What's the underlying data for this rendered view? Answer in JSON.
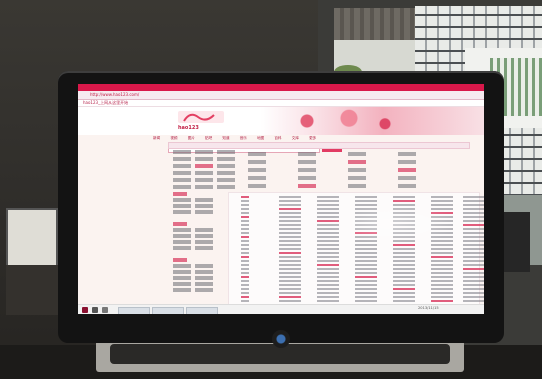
{
  "scene": {
    "description_colors": {
      "browser_accent": "#d8184a",
      "screen_bg": "#fbf3f0",
      "bezel": "#131313"
    }
  },
  "browser": {
    "url": "http://www.hao123.com/",
    "tab_title": "hao123_上网从这里开始",
    "logo_text": "hao123",
    "nav_items": [
      "新闻",
      "视频",
      "图片",
      "贴吧",
      "知道",
      "音乐",
      "地图",
      "百科",
      "文库",
      "更多"
    ],
    "clock": "2013/11/15"
  }
}
